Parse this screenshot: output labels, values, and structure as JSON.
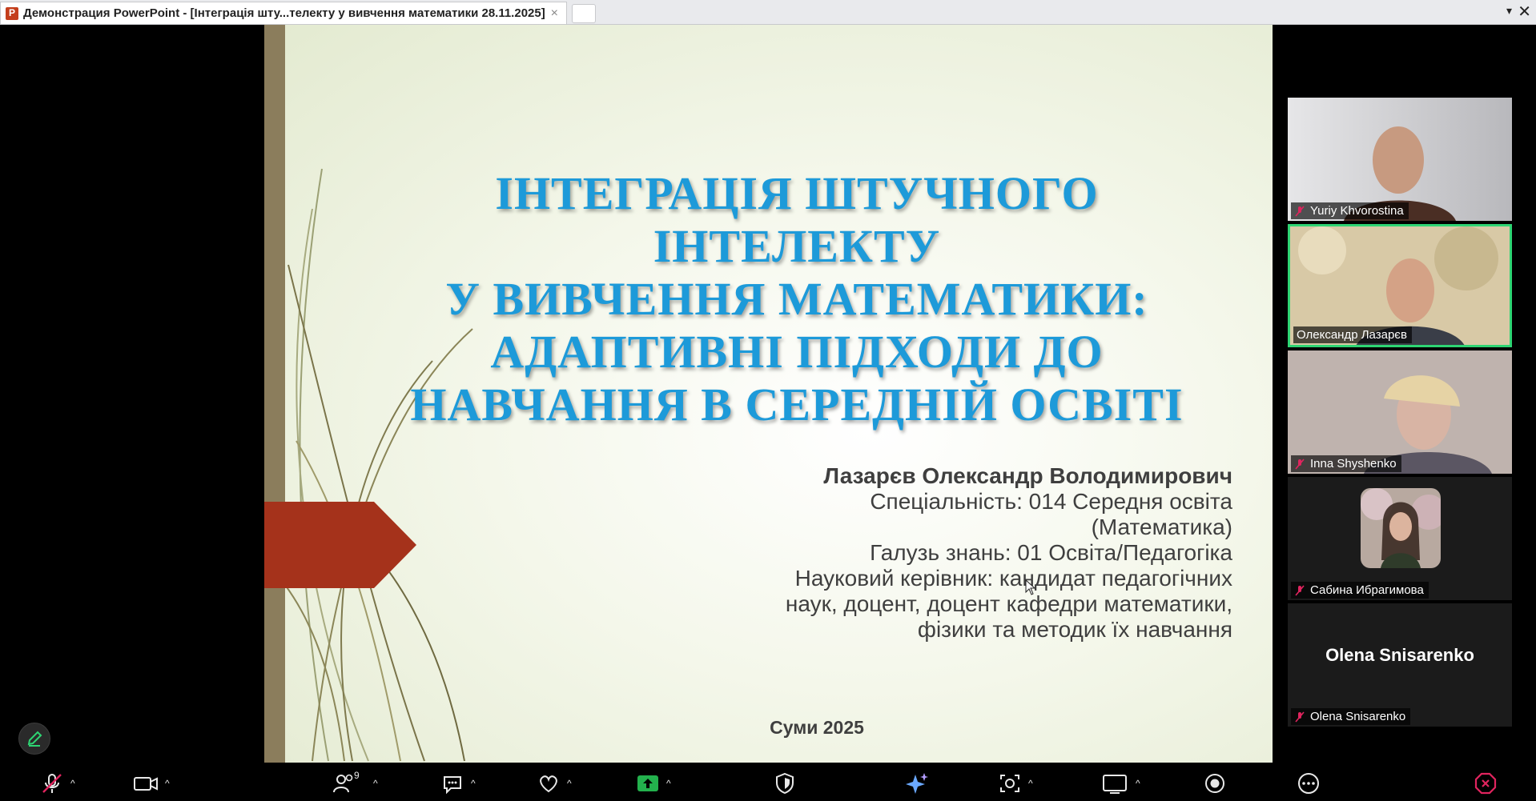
{
  "window": {
    "tab_title": "Демонстрация PowerPoint - [Інтеграція шту...телекту у вивчення математики 28.11.2025]",
    "tab_close": "×",
    "dropdown": "▾",
    "close": "✕"
  },
  "slide": {
    "title_lines": [
      "ІНТЕГРАЦІЯ ШТУЧНОГО ІНТЕЛЕКТУ",
      "У ВИВЧЕННЯ МАТЕМАТИКИ:",
      "АДАПТИВНІ ПІДХОДИ ДО",
      "НАВЧАННЯ В СЕРЕДНІЙ ОСВІТІ"
    ],
    "author": "Лазарєв Олександр Володимирович",
    "info_lines": [
      "Спеціальність: 014 Середня освіта",
      "(Математика)",
      "Галузь знань: 01 Освіта/Педагогіка",
      "Науковий керівник: кандидат педагогічних",
      "наук, доцент, доцент кафедри математики,",
      "фізики та методик їх навчання"
    ],
    "city": "Суми 2025",
    "colors": {
      "title": "#1d9ad9",
      "arrow": "#a5321b",
      "bar": "#8b7d5c"
    }
  },
  "participants": [
    {
      "name": "Yuriy Khvorostina",
      "muted": true,
      "active": false
    },
    {
      "name": "Олександр Лазарєв",
      "muted": false,
      "active": true
    },
    {
      "name": "Inna Shyshenko",
      "muted": true,
      "active": false
    },
    {
      "name": "Сабина Ибрагимова",
      "muted": true,
      "active": false
    },
    {
      "name": "Olena Snisarenko",
      "display_name": "Olena Snisarenko",
      "muted": true,
      "active": false
    }
  ],
  "toolbar": {
    "participants_count": "9",
    "caret": "^",
    "accent": "#2ed573",
    "share_color": "#23b14d",
    "leave_color": "#e0245e"
  }
}
